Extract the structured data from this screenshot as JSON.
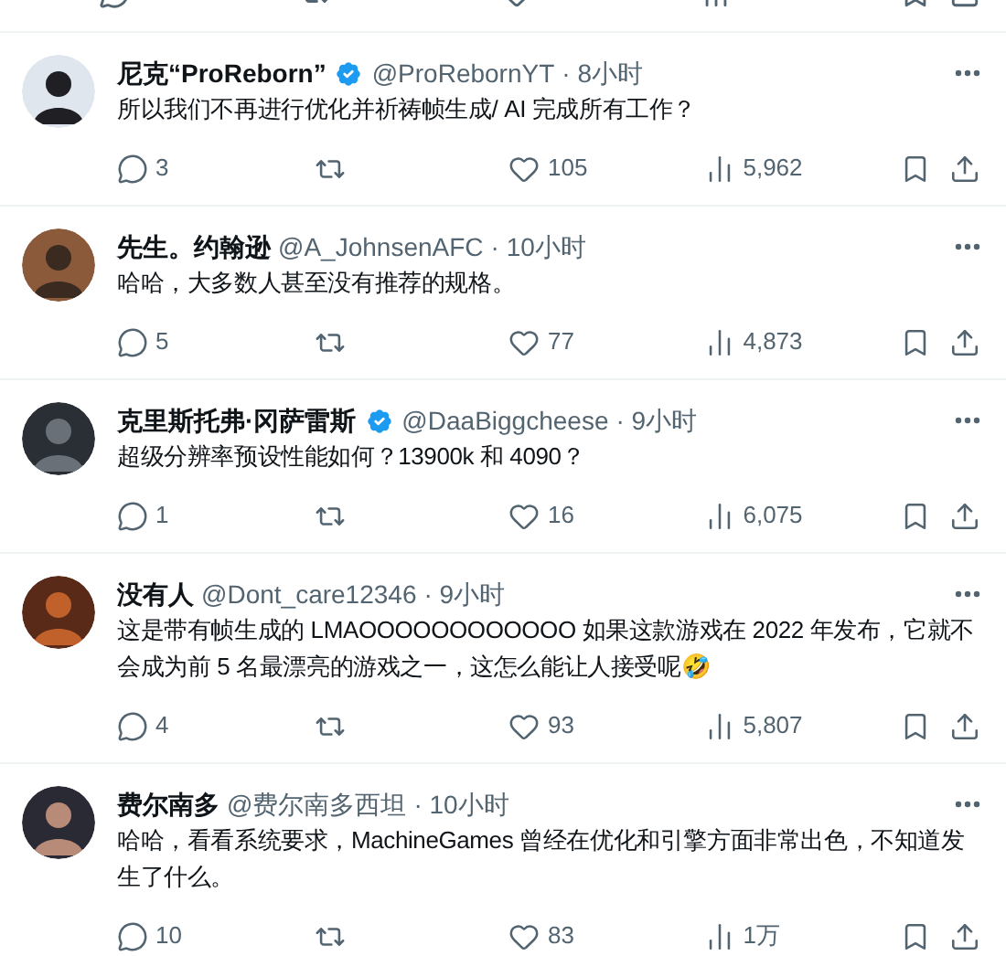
{
  "tweets": [
    {
      "name": "尼克“ProReborn”",
      "verified": true,
      "handle": "@ProRebornYT",
      "time": "· 8小时",
      "text": "所以我们不再进行优化并祈祷帧生成/ AI 完成所有工作？",
      "replies": "3",
      "likes": "105",
      "views": "5,962"
    },
    {
      "name": "先生。约翰逊",
      "verified": false,
      "handle": "@A_JohnsenAFC",
      "time": "· 10小时",
      "text": "哈哈，大多数人甚至没有推荐的规格。",
      "replies": "5",
      "likes": "77",
      "views": "4,873"
    },
    {
      "name": "克里斯托弗·冈萨雷斯",
      "verified": true,
      "handle": "@DaaBiggcheese",
      "time": "· 9小时",
      "text": "超级分辨率预设性能如何？13900k 和 4090？",
      "replies": "1",
      "likes": "16",
      "views": "6,075"
    },
    {
      "name": "没有人",
      "verified": false,
      "handle": "@Dont_care12346",
      "time": "· 9小时",
      "text": "这是带有帧生成的 LMAOOOOOOOOOOOO 如果这款游戏在 2022 年发布，它就不会成为前 5 名最漂亮的游戏之一，这怎么能让人接受呢🤣",
      "replies": "4",
      "likes": "93",
      "views": "5,807"
    },
    {
      "name": "费尔南多",
      "verified": false,
      "handle": "@费尔南多西坦",
      "time": "· 10小时",
      "text": "哈哈，看看系统要求，MachineGames 曾经在优化和引擎方面非常出色，不知道发生了什么。",
      "replies": "10",
      "likes": "83",
      "views": "1万"
    }
  ]
}
